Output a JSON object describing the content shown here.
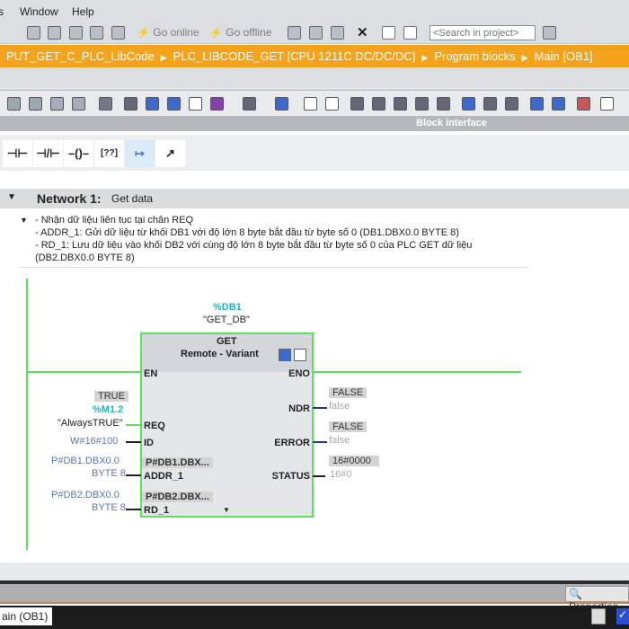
{
  "menu": {
    "items": [
      "s",
      "Window",
      "Help"
    ]
  },
  "toolbar": {
    "go_online": "Go online",
    "go_offline": "Go offline",
    "search_placeholder": "<Search in project>"
  },
  "breadcrumb": [
    "PUT_GET_C_PLC_LibCode",
    "PLC_LIBCODE_GET [CPU 1211C DC/DC/DC]",
    "Program blocks",
    "Main [OB1]"
  ],
  "block_interface": "Block interface",
  "instructions": [
    "⊣⊢",
    "⊣/⊢",
    "–()–",
    "[??]",
    "↦",
    "↗"
  ],
  "network": {
    "title": "Network 1:",
    "comment": "Get data",
    "comment_lines": [
      "- Nhận dữ liệu liên tục tại chân REQ",
      "- ADDR_1: Gửi dữ liệu từ khối DB1 với độ lớn 8 byte bắt đầu từ byte số 0 (DB1.DBX0.0 BYTE 8)",
      "- RD_1: Lưu dữ liệu vào khối DB2 với cùng độ lớn 8 byte bắt đầu từ byte số 0 của PLC GET dữ liệu",
      "(DB2.DBX0.0 BYTE 8)"
    ]
  },
  "block": {
    "db_address": "%DB1",
    "db_name": "\"GET_DB\"",
    "type": "GET",
    "subtitle": "Remote  -  Variant",
    "pins": {
      "en": "EN",
      "eno": "ENO",
      "req": "REQ",
      "id": "ID",
      "addr": "ADDR_1",
      "rd": "RD_1",
      "ndr": "NDR",
      "error": "ERROR",
      "status": "STATUS"
    },
    "req_value": "TRUE",
    "req_address": "%M1.2",
    "req_tag": "\"AlwaysTRUE\"",
    "id_value": "W#16#100",
    "addr_operand": [
      "P#DB1.DBX0.0",
      "BYTE 8"
    ],
    "addr_value": "P#DB1.DBX...",
    "rd_operand": [
      "P#DB2.DBX0.0",
      "BYTE 8"
    ],
    "rd_value": "P#DB2.DBX...",
    "ndr_value": "FALSE",
    "ndr_operand": "false",
    "error_value": "FALSE",
    "error_operand": "false",
    "status_value": "16#0000",
    "status_operand": "16#0"
  },
  "properties": "Properties",
  "status_tab": "ain (OB1)"
}
